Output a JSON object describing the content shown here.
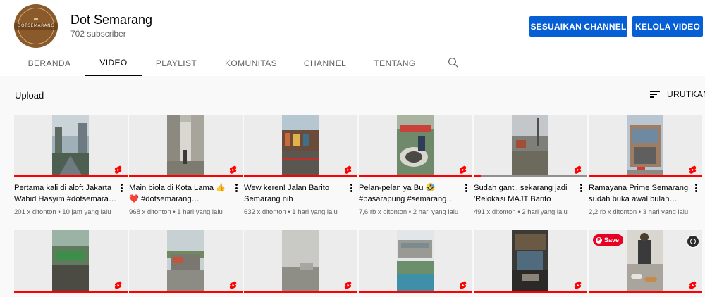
{
  "channel": {
    "name": "Dot Semarang",
    "subscribers": "702 subscriber",
    "avatar_text": "DOTSEMARANG",
    "avatar_color": "#8b5a2b"
  },
  "buttons": {
    "customize": "SESUAIKAN CHANNEL",
    "manage": "KELOLA VIDEO",
    "color": "#065fd4"
  },
  "tabs": [
    {
      "label": "BERANDA",
      "active": false
    },
    {
      "label": "VIDEO",
      "active": true
    },
    {
      "label": "PLAYLIST",
      "active": false
    },
    {
      "label": "KOMUNITAS",
      "active": false
    },
    {
      "label": "CHANNEL",
      "active": false
    },
    {
      "label": "TENTANG",
      "active": false
    }
  ],
  "tab_search_icon": "search-icon",
  "section": {
    "title": "Upload",
    "sort_label": "URUTKAN",
    "sort_icon": "sort-icon"
  },
  "videos_row1": [
    {
      "title": "Pertama kali di aloft Jakarta Wahid Hasyim #dotsemara…",
      "meta": "201 x ditonton • 10 jam yang lalu",
      "watched": 1.0
    },
    {
      "title": "Main biola di Kota Lama 👍 ❤️ #dotsemarang…",
      "meta": "968 x ditonton • 1 hari yang lalu",
      "watched": 1.0
    },
    {
      "title": "Wew keren! Jalan Barito Semarang nih #dotsemaran…",
      "meta": "632 x ditonton • 1 hari yang lalu",
      "watched": 1.0
    },
    {
      "title": "Pelan-pelan ya Bu 🤣 #pasarapung #semarang…",
      "meta": "7,6 rb x ditonton • 2 hari yang lalu",
      "watched": 1.0
    },
    {
      "title": "Sudah ganti, sekarang jadi 'Relokasi MAJT Barito Baru'…",
      "meta": "491 x ditonton • 2 hari yang lalu",
      "watched": 0.1
    },
    {
      "title": "Ramayana Prime Semarang sudah buka awal bulan…",
      "meta": "2,2 rb x ditonton • 3 hari yang lalu",
      "watched": 1.0
    }
  ],
  "videos_row2_count": 6,
  "overlay": {
    "save_label": "Save",
    "save_color": "#e60023",
    "lens_icon": "visual-search-icon"
  },
  "shorts_icon": "shorts-icon",
  "menu_icon": "more-vert-icon"
}
